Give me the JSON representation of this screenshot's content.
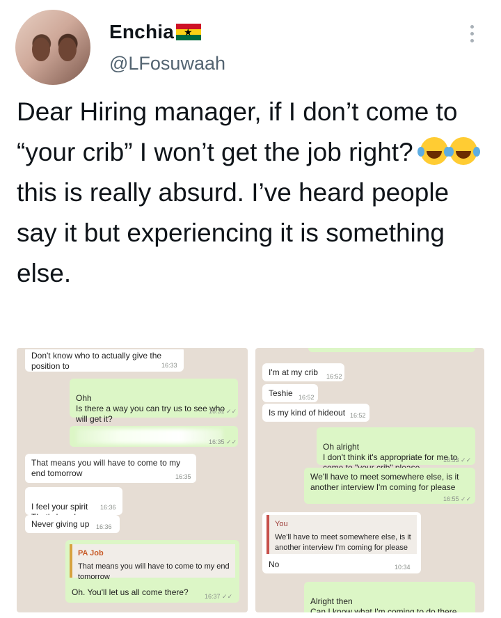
{
  "profile": {
    "display_name": "Enchia",
    "handle": "@LFosuwaah",
    "flag_colors": [
      "#ce1126",
      "#fcd116",
      "#006b3f"
    ]
  },
  "tweet": {
    "text_part1": "Dear Hiring manager, if I don’t come to “your crib” I won’t get the job right? ",
    "emojis": [
      "face-with-tears-of-joy",
      "face-with-tears-of-joy"
    ],
    "text_part2": " this is really absurd. I’ve heard people say it but experiencing it is something else."
  },
  "left_chat": {
    "messages": [
      {
        "dir": "in",
        "text": "Don't know who to actually give the position to",
        "time": "16:33"
      },
      {
        "dir": "out",
        "text": "Ohh\nIs there a way you can try us to see who will get it?",
        "time": "16:31 ✓✓"
      },
      {
        "dir": "out",
        "text": "",
        "time": "16:35 ✓✓"
      },
      {
        "dir": "in",
        "text": "That means you will have to come to my end tomorrow",
        "time": "16:35"
      },
      {
        "dir": "in",
        "text": "I feel your spirit\nThat's how I am",
        "time": "16:36"
      },
      {
        "dir": "in",
        "text": "Never giving up",
        "time": "16:36"
      }
    ],
    "reply": {
      "quoted_name": "PA Job",
      "quoted_text": "That means you will have to come to my end tomorrow",
      "text": "Oh. You'll let us all come there?",
      "time": "16:37 ✓✓"
    }
  },
  "right_chat": {
    "messages": [
      {
        "dir": "in",
        "text": "I'm at my crib",
        "time": "16:52"
      },
      {
        "dir": "in",
        "text": "Teshie",
        "time": "16:52"
      },
      {
        "dir": "in",
        "text": "Is my kind of hideout",
        "time": "16:52"
      },
      {
        "dir": "out",
        "text": "Oh alright\nI don't think it's appropriate for me to come to \"your crib\" please",
        "time": "16:53 ✓✓"
      },
      {
        "dir": "out",
        "text": "We'll have to meet somewhere else, is it another interview I'm coming for please",
        "time": "16:55 ✓✓"
      }
    ],
    "reply": {
      "quoted_name": "You",
      "quoted_text": "We'll have to meet somewhere else, is it another interview I'm coming for please",
      "text": "No",
      "time": "10:34"
    },
    "last": {
      "text": "Alright then\nCan I know what I'm coming to do there please",
      "time": ""
    }
  }
}
